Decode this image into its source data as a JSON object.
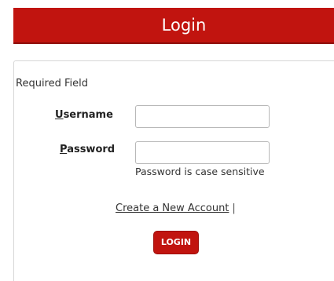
{
  "header": {
    "title": "Login"
  },
  "form": {
    "required_note": "Required Field",
    "username": {
      "label_accel": "U",
      "label_rest": "sername",
      "value": "",
      "placeholder": ""
    },
    "password": {
      "label_accel": "P",
      "label_rest": "assword",
      "value": "",
      "placeholder": "",
      "hint": "Password is case sensitive"
    },
    "create_account_link": "Create a New Account",
    "separator": "|",
    "login_button": "LOGIN"
  },
  "colors": {
    "accent": "#c1140f",
    "border": "#d6d6d6"
  }
}
